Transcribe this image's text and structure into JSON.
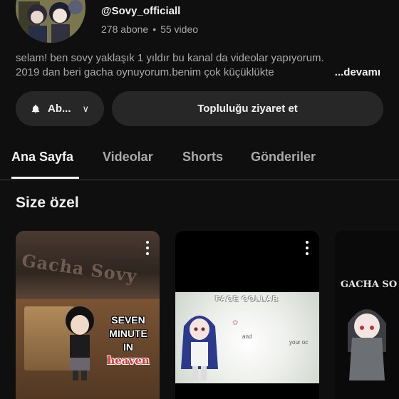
{
  "channel": {
    "handle": "@Sovy_officiall",
    "subscribers": "278 abone",
    "separator": "•",
    "videos": "55 video",
    "description_line1": "selam! ben sovy yaklaşık 1 yıldır bu kanal da videolar yapıyorum.",
    "description_line2": "2019 dan beri gacha oynuyorum.benim çok küçüklükte",
    "more_label": "...devamı"
  },
  "actions": {
    "subscribe_label": "Ab...",
    "subscribe_chevron": "∨",
    "community_label": "Topluluğu ziyaret et"
  },
  "tabs": [
    {
      "label": "Ana Sayfa",
      "active": true
    },
    {
      "label": "Videolar",
      "active": false
    },
    {
      "label": "Shorts",
      "active": false
    },
    {
      "label": "Gönderiler",
      "active": false
    }
  ],
  "section": {
    "title": "Size özel"
  },
  "cards": [
    {
      "watermark": "Gacha Sovy",
      "overlay_line1": "SEVEN",
      "overlay_line2": "MINUTE",
      "overlay_line3": "IN",
      "overlay_line4": "heaven"
    },
    {
      "collab_title": "FACE COLLAB",
      "and_text": "and",
      "oc_text": "your oc"
    },
    {
      "watermark": "GACHA SO"
    }
  ],
  "colors": {
    "background": "#0f0f0f",
    "button_bg": "#272727",
    "primary_text": "#f1f1f1",
    "secondary_text": "#aaaaaa",
    "divider": "#3a3a3a"
  },
  "icons": {
    "bell": "bell-icon",
    "chevron": "chevron-down-icon",
    "kebab": "more-vert-icon"
  }
}
